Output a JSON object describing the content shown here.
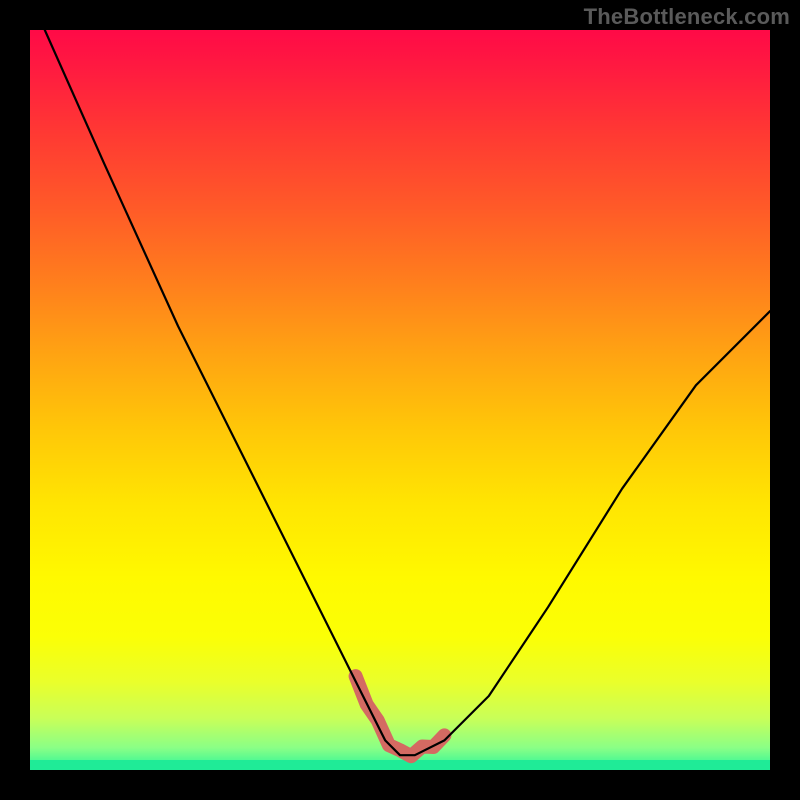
{
  "watermark": "TheBottleneck.com",
  "chart_data": {
    "type": "line",
    "title": "",
    "xlabel": "",
    "ylabel": "",
    "xlim": [
      0,
      100
    ],
    "ylim": [
      0,
      100
    ],
    "background": "heat-gradient",
    "note": "Approximate V-shaped bottleneck curve; minimum region highlighted in salmon.",
    "series": [
      {
        "name": "curve",
        "x": [
          2,
          10,
          20,
          30,
          38,
          44,
          48,
          50,
          52,
          56,
          62,
          70,
          80,
          90,
          100
        ],
        "values": [
          100,
          82,
          60,
          40,
          24,
          12,
          4,
          2,
          2,
          4,
          10,
          22,
          38,
          52,
          62
        ]
      }
    ],
    "highlight_region": {
      "name": "optimal-range",
      "x_start": 44,
      "x_end": 56,
      "color": "#d46a62"
    },
    "gradient_stops": [
      {
        "pos": 0,
        "color": "#ff0a47"
      },
      {
        "pos": 50,
        "color": "#ffc708"
      },
      {
        "pos": 75,
        "color": "#fff900"
      },
      {
        "pos": 100,
        "color": "#27f59a"
      }
    ]
  }
}
